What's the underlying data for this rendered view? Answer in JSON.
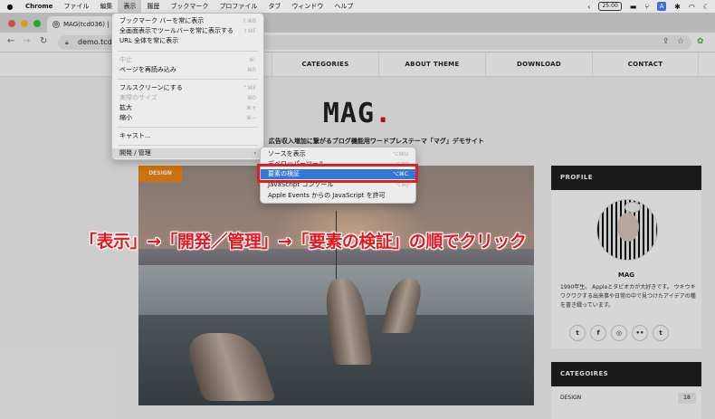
{
  "menubar": {
    "apple": "",
    "app": "Chrome",
    "items": [
      "ファイル",
      "編集",
      "表示",
      "履歴",
      "ブックマーク",
      "プロファイル",
      "タブ",
      "ウィンドウ",
      "ヘルプ"
    ],
    "battery": "25:00"
  },
  "tab": {
    "title": "MAG(tcd036) | ア"
  },
  "address": {
    "url": "demo.tcd-th"
  },
  "site": {
    "nav": [
      "CATEGORIES",
      "ABOUT THEME",
      "DOWNLOAD",
      "CONTACT"
    ],
    "logo": "MAG",
    "logo_dot": ".",
    "tagline": "アクセス数、広告収入増加に繋がるブログ機能用ワードプレステーマ「マグ」デモサイト",
    "badge": "DESIGN",
    "profile": {
      "header": "PROFILE",
      "name": "MAG",
      "bio": "1990年生。 Appleとタピオカが大好きです。 ウキウキワクワクする出来事や日常の中で見つけたアイデアの種を書き綴っています。",
      "social_icons": [
        "twitter-icon",
        "facebook-icon",
        "instagram-icon",
        "flickr-icon",
        "tumblr-icon"
      ],
      "social_glyphs": [
        "t",
        "f",
        "◎",
        "••",
        "t"
      ]
    },
    "categories": {
      "header": "CATEGOIRES",
      "row_label": "DESIGN",
      "row_count": "18"
    }
  },
  "view_menu": {
    "items": [
      {
        "label": "ブックマーク バーを常に表示",
        "shortcut": "⇧⌘B",
        "disabled": false
      },
      {
        "label": "全画面表示でツールバーを常に表示する",
        "shortcut": "⇧⌘F",
        "disabled": false
      },
      {
        "label": "URL 全体を常に表示",
        "shortcut": "",
        "disabled": false
      },
      {
        "label": "中止",
        "shortcut": "⌘.",
        "disabled": true
      },
      {
        "label": "ページを再読み込み",
        "shortcut": "⌘R",
        "disabled": false
      },
      {
        "label": "フルスクリーンにする",
        "shortcut": "⌃⌘F",
        "disabled": false
      },
      {
        "label": "実際のサイズ",
        "shortcut": "⌘0",
        "disabled": true
      },
      {
        "label": "拡大",
        "shortcut": "⌘+",
        "disabled": false
      },
      {
        "label": "縮小",
        "shortcut": "⌘−",
        "disabled": false
      },
      {
        "label": "キャスト...",
        "shortcut": "",
        "disabled": false
      },
      {
        "label": "開発 / 管理",
        "shortcut": "",
        "disabled": false
      }
    ],
    "submenu_arrow": "›"
  },
  "dev_menu": {
    "items": [
      {
        "label": "ソースを表示",
        "shortcut": "⌥⌘U"
      },
      {
        "label": "デベロッパーツール",
        "shortcut": "⌥⌘I"
      },
      {
        "label": "要素の検証",
        "shortcut": "⌥⌘C"
      },
      {
        "label": "JavaScript コンソール",
        "shortcut": "⌥⌘J"
      },
      {
        "label": "Apple Events からの JavaScript を許可",
        "shortcut": ""
      }
    ]
  },
  "annotation": {
    "text": "「表示」→「開発／管理」→「要素の検証」の順でクリック"
  },
  "colors": {
    "accent_red": "#e7161f",
    "badge_orange": "#f5880f",
    "menu_highlight": "#3478d6"
  }
}
